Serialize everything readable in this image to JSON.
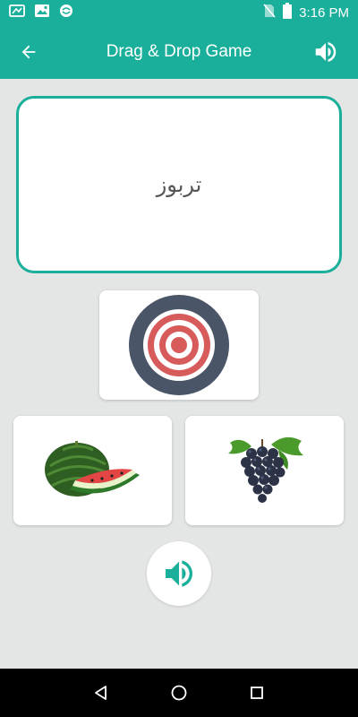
{
  "status_bar": {
    "time": "3:16 PM",
    "icons": [
      "signal-icon",
      "image-icon",
      "sync-icon",
      "no-sim-icon",
      "battery-icon"
    ]
  },
  "app_bar": {
    "title": "Drag & Drop Game",
    "back_icon": "arrow-left-icon",
    "sound_icon": "volume-icon"
  },
  "word_card": {
    "word": "تربوز"
  },
  "target": {
    "icon": "target-icon",
    "colors": {
      "outer": "#4b5568",
      "ring": "#d85b5b",
      "white": "#ffffff"
    }
  },
  "options": [
    {
      "name": "watermelon",
      "icon": "watermelon-image"
    },
    {
      "name": "grapes",
      "icon": "grapes-image"
    }
  ],
  "bottom_sound": {
    "icon": "volume-icon",
    "color": "#1aaf9b"
  },
  "nav_bar": {
    "buttons": [
      "back-triangle-icon",
      "home-circle-icon",
      "recents-square-icon"
    ]
  },
  "colors": {
    "accent": "#1aaf9b",
    "background": "#e4e6e6"
  }
}
